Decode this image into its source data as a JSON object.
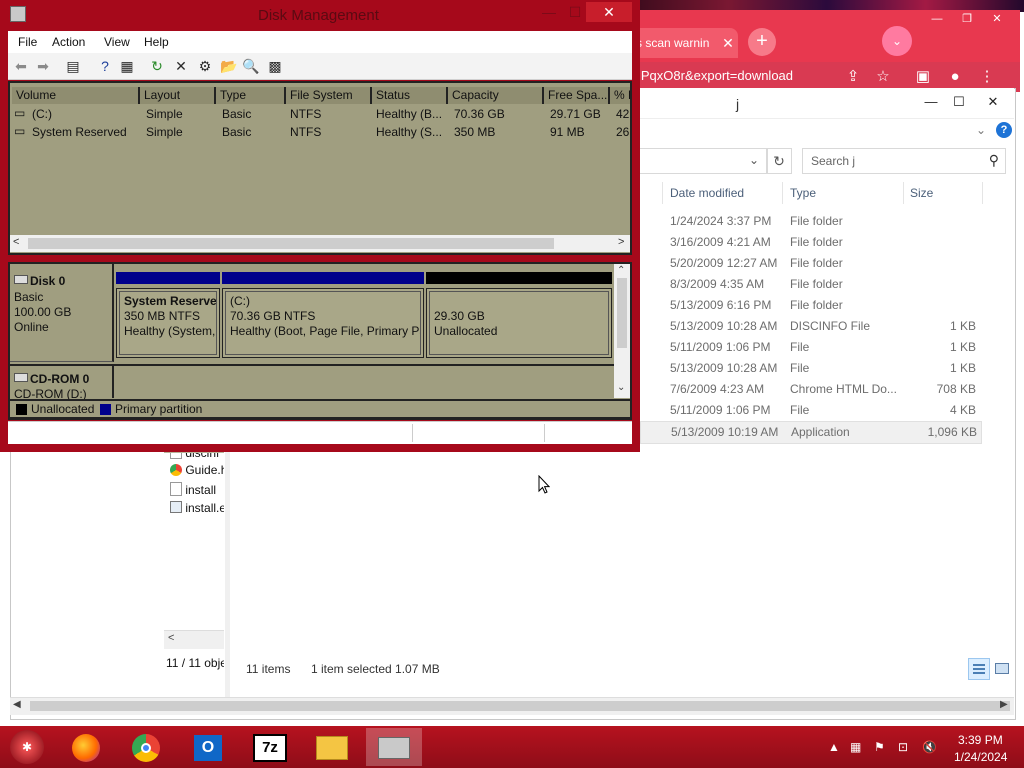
{
  "chrome": {
    "tab_title": "s scan warnin",
    "tab_close": "✕",
    "new_tab": "+",
    "url": "lPqxO8r&export=download",
    "profile": "⌄"
  },
  "explorer": {
    "title": "j",
    "search_placeholder": "Search j",
    "columns": {
      "date_modified": "Date modified",
      "type": "Type",
      "size": "Size"
    },
    "files": [
      {
        "date": "1/24/2024 3:37 PM",
        "type": "File folder",
        "size": ""
      },
      {
        "date": "3/16/2009 4:21 AM",
        "type": "File folder",
        "size": ""
      },
      {
        "date": "5/20/2009 12:27 AM",
        "type": "File folder",
        "size": ""
      },
      {
        "date": "8/3/2009 4:35 AM",
        "type": "File folder",
        "size": ""
      },
      {
        "date": "5/13/2009 6:16 PM",
        "type": "File folder",
        "size": ""
      },
      {
        "date": "5/13/2009 10:28 AM",
        "type": "DISCINFO File",
        "size": "1 KB"
      },
      {
        "date": "5/11/2009 1:06 PM",
        "type": "File",
        "size": "1 KB"
      },
      {
        "date": "5/13/2009 10:28 AM",
        "type": "File",
        "size": "1 KB"
      },
      {
        "date": "7/6/2009 4:23 AM",
        "type": "Chrome HTML Do...",
        "size": "708 KB"
      },
      {
        "date": "5/11/2009 1:06 PM",
        "type": "File",
        "size": "4 KB"
      },
      {
        "date": "5/13/2009 10:19 AM",
        "type": "Application",
        "size": "1,096 KB"
      }
    ],
    "nav_items": [
      "discinf",
      "Guide.h",
      "install",
      "install.e"
    ],
    "status_left": "11 / 11 obje",
    "status_items": "11 items",
    "status_selected": "1 item selected  1.07 MB"
  },
  "disk_management": {
    "title": "Disk Management",
    "menu": [
      "File",
      "Action",
      "View",
      "Help"
    ],
    "columns": [
      "Volume",
      "Layout",
      "Type",
      "File System",
      "Status",
      "Capacity",
      "Free Spa...",
      "% F"
    ],
    "volumes": [
      {
        "volume": "(C:)",
        "layout": "Simple",
        "type": "Basic",
        "fs": "NTFS",
        "status": "Healthy (B...",
        "capacity": "70.36 GB",
        "free": "29.71 GB",
        "pct": "42"
      },
      {
        "volume": "System Reserved",
        "layout": "Simple",
        "type": "Basic",
        "fs": "NTFS",
        "status": "Healthy (S...",
        "capacity": "350 MB",
        "free": "91 MB",
        "pct": "26"
      }
    ],
    "disk0": {
      "name": "Disk 0",
      "kind": "Basic",
      "size": "100.00 GB",
      "state": "Online",
      "partitions": [
        {
          "title": "System Reserve",
          "line1": "350 MB NTFS",
          "line2": "Healthy (System,"
        },
        {
          "title": "(C:)",
          "line1": "70.36 GB NTFS",
          "line2": "Healthy (Boot, Page File, Primary Pa"
        },
        {
          "title": "",
          "line1": "29.30 GB",
          "line2": "Unallocated"
        }
      ]
    },
    "cdrom": {
      "name": "CD-ROM 0",
      "sub": "CD-ROM (D:)"
    },
    "legend": {
      "unallocated": "Unallocated",
      "primary": "Primary partition"
    },
    "colors": {
      "primary": "#00008b",
      "unallocated": "#000000",
      "panel": "#a09e80"
    }
  },
  "taskbar": {
    "apps": [
      "firefox-icon",
      "chrome-icon",
      "outlook-icon",
      "7zip-icon",
      "file-explorer-icon",
      "disk-management-icon"
    ],
    "outlook_label": "O",
    "sevenzip_label": "7z",
    "time": "3:39 PM",
    "date": "1/24/2024"
  }
}
